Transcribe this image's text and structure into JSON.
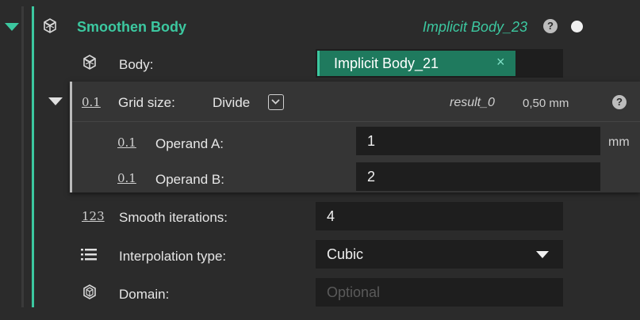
{
  "header": {
    "title": "Smoothen Body",
    "reference": "Implicit Body_23",
    "help": "?"
  },
  "body_row": {
    "label": "Body:",
    "chip_text": "Implicit Body_21",
    "chip_remove": "×"
  },
  "grid_size": {
    "icon_text": "0.1",
    "label": "Grid size:",
    "mode": "Divide",
    "result_name": "result_0",
    "result_value": "0,50 mm",
    "help": "?",
    "operand_a": {
      "icon_text": "0.1",
      "label": "Operand A:",
      "value": "1",
      "unit": "mm"
    },
    "operand_b": {
      "icon_text": "0.1",
      "label": "Operand B:",
      "value": "2"
    }
  },
  "smooth_iterations": {
    "icon_text": "123",
    "label": "Smooth iterations:",
    "value": "4"
  },
  "interpolation": {
    "label": "Interpolation type:",
    "value": "Cubic"
  },
  "domain": {
    "label": "Domain:",
    "placeholder": "Optional"
  },
  "colors": {
    "accent": "#3cc8a0",
    "chip_bg": "#1f7a5e",
    "panel_bg": "#2b2b2b",
    "field_bg": "#1e1e1e"
  }
}
